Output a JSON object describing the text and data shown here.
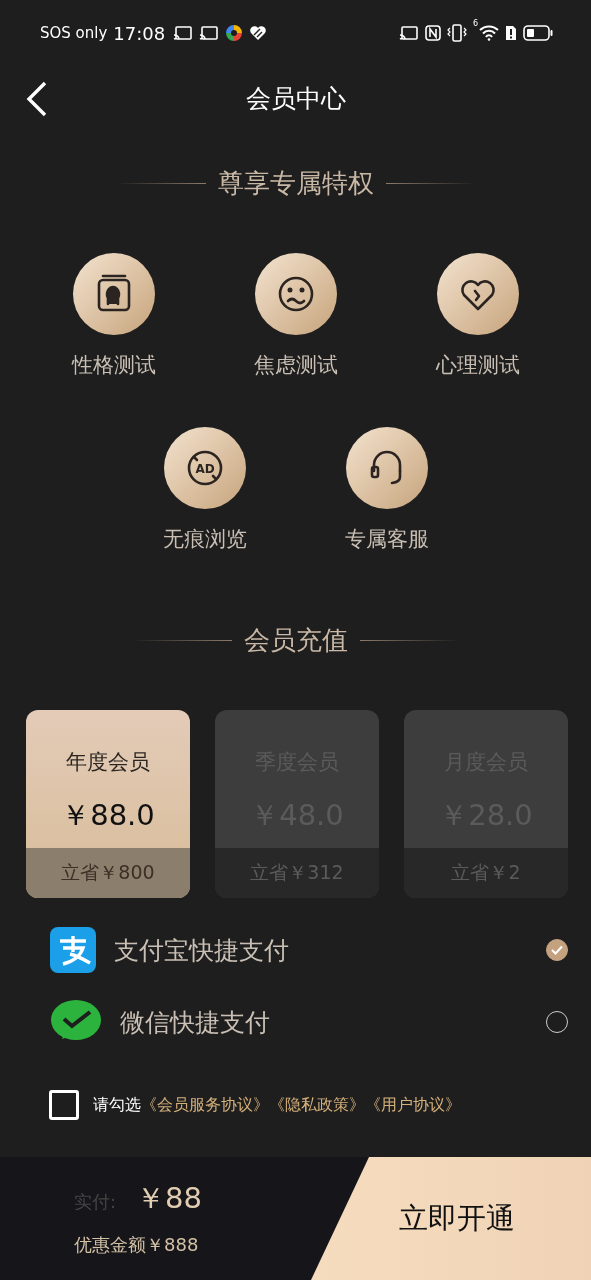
{
  "status_bar": {
    "carrier": "SOS only",
    "time": "17:08",
    "wifi_badge": "6"
  },
  "header": {
    "title": "会员中心"
  },
  "privileges": {
    "title": "尊享专属特权",
    "items": [
      {
        "label": "性格测试",
        "kind": "portrait"
      },
      {
        "label": "焦虑测试",
        "kind": "face"
      },
      {
        "label": "心理测试",
        "kind": "heart"
      },
      {
        "label": "无痕浏览",
        "kind": "ad",
        "icon_text": "AD"
      },
      {
        "label": "专属客服",
        "kind": "headset"
      }
    ]
  },
  "recharge": {
    "title": "会员充值",
    "plans": [
      {
        "name": "年度会员",
        "price": "￥88.0",
        "saving": "立省￥800",
        "selected": true
      },
      {
        "name": "季度会员",
        "price": "￥48.0",
        "saving": "立省￥312",
        "selected": false
      },
      {
        "name": "月度会员",
        "price": "￥28.0",
        "saving": "立省￥2",
        "selected": false
      }
    ]
  },
  "payments": [
    {
      "label": "支付宝快捷支付",
      "kind": "alipay",
      "selected": true
    },
    {
      "label": "微信快捷支付",
      "kind": "wechat",
      "selected": false
    }
  ],
  "agreement": {
    "checked": false,
    "prefix": "请勾选",
    "links": [
      "《会员服务协议》",
      "《隐私政策》",
      "《用户协议》"
    ]
  },
  "footer": {
    "paid_label": "实付:",
    "paid_amount": "￥88",
    "discount": "优惠金额￥888",
    "button": "立即开通"
  }
}
